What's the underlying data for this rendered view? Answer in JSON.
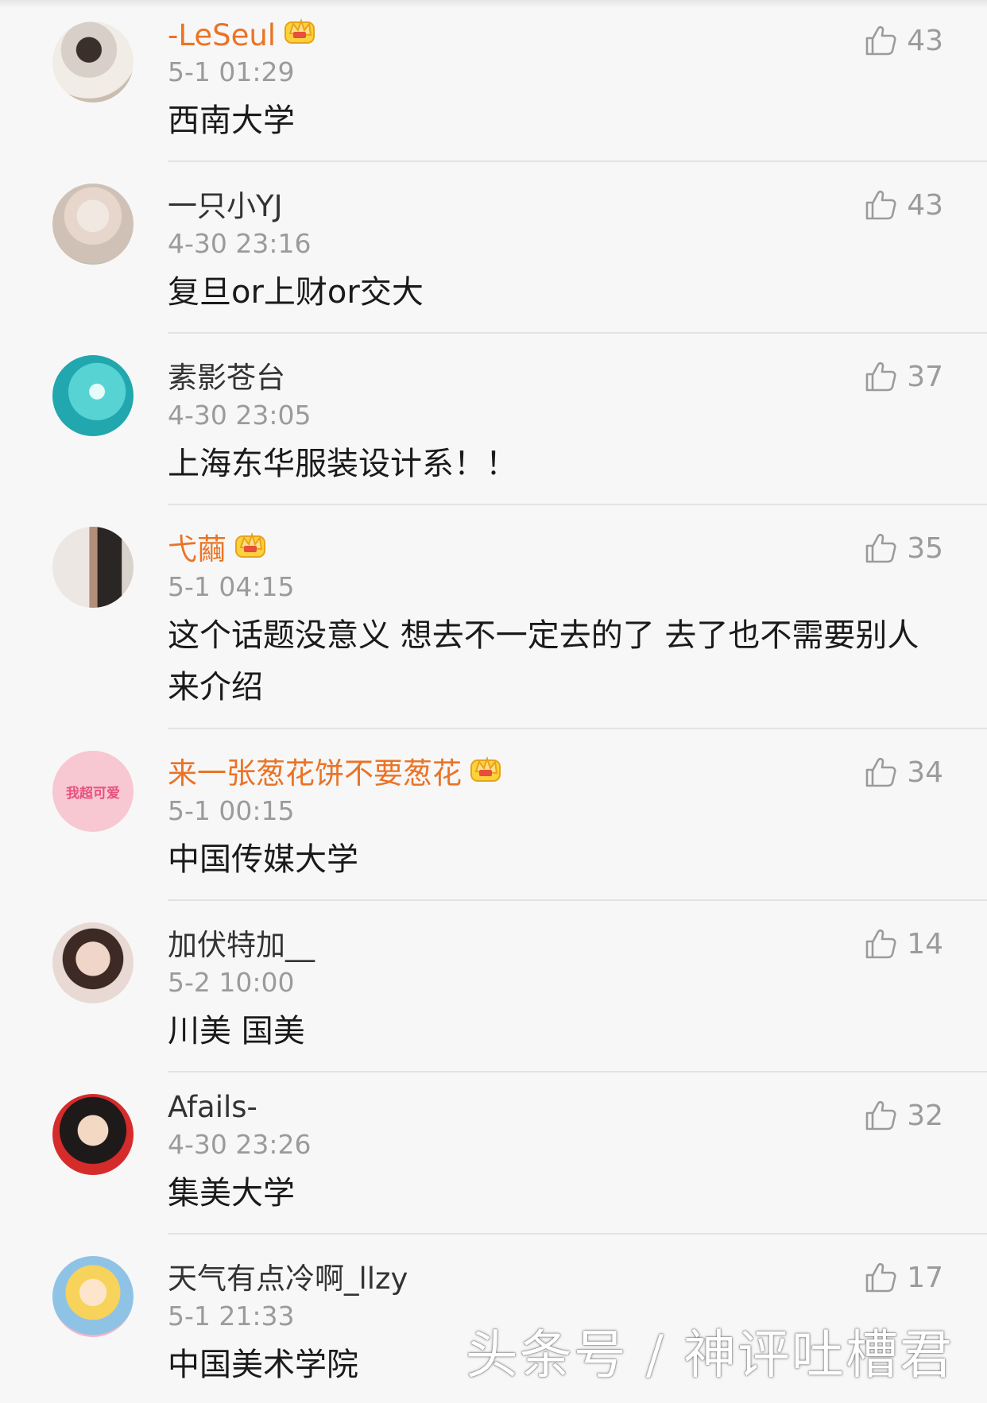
{
  "comments": [
    {
      "username": "-LeSeul",
      "time": "5-1 01:29",
      "text": "西南大学",
      "likes": "43",
      "vip": true
    },
    {
      "username": "一只小YJ",
      "time": "4-30 23:16",
      "text": "复旦or上财or交大",
      "likes": "43",
      "vip": false
    },
    {
      "username": "素影苍台",
      "time": "4-30 23:05",
      "text": "上海东华服装设计系！！",
      "likes": "37",
      "vip": false
    },
    {
      "username": "弋繭",
      "time": "5-1 04:15",
      "text": "这个话题没意义 想去不一定去的了 去了也不需要别人来介绍",
      "likes": "35",
      "vip": true
    },
    {
      "username": "来一张葱花饼不要葱花",
      "time": "5-1 00:15",
      "text": "中国传媒大学",
      "likes": "34",
      "vip": true
    },
    {
      "username": "加伏特加__",
      "time": "5-2 10:00",
      "text": "川美 国美",
      "likes": "14",
      "vip": false
    },
    {
      "username": "Afails-",
      "time": "4-30 23:26",
      "text": "集美大学",
      "likes": "32",
      "vip": false
    },
    {
      "username": "天气有点冷啊_llzy",
      "time": "5-1 21:33",
      "text": "中国美术学院",
      "likes": "17",
      "vip": false
    }
  ],
  "avatar_5_text": "我超可爱",
  "watermark": "头条号 / 神评吐槽君",
  "colors": {
    "vip_name": "#eb7325",
    "background": "#f7f7f7",
    "meta": "#9b9b9b",
    "divider": "#e3e3e3"
  },
  "icons": {
    "like": "thumbs-up-icon",
    "vip": "crown-icon"
  }
}
